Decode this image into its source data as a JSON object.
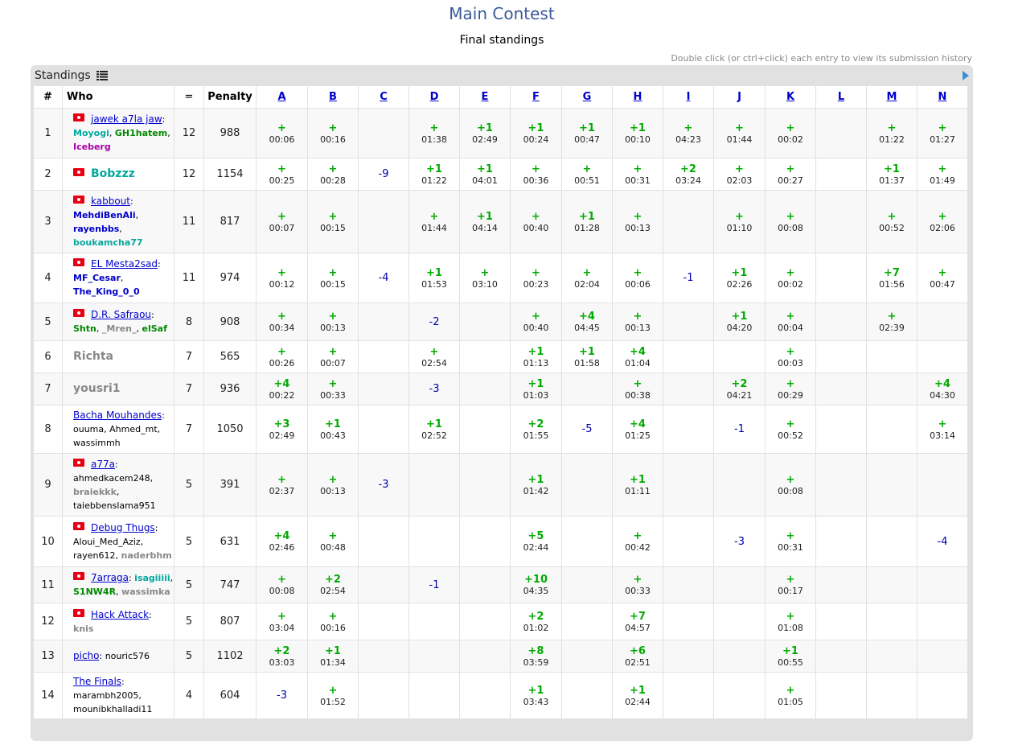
{
  "page": {
    "title": "Main Contest",
    "subtitle": "Final standings",
    "hint": "Double click (or ctrl+click) each entry to view its submission history",
    "box_title": "Standings"
  },
  "columns": {
    "rank": "#",
    "who": "Who",
    "solved": "=",
    "penalty": "Penalty",
    "problems": [
      "A",
      "B",
      "C",
      "D",
      "E",
      "F",
      "G",
      "H",
      "I",
      "J",
      "K",
      "L",
      "M",
      "N"
    ]
  },
  "rows": [
    {
      "rank": "1",
      "flag": true,
      "team": "jawek a7la jaw",
      "members": [
        [
          "Moyogi",
          "teal"
        ],
        [
          "GH1hatem",
          "green"
        ],
        [
          "Iceberg",
          "purple"
        ]
      ],
      "solved": "12",
      "penalty": "988",
      "cells": [
        [
          "+",
          "00:06"
        ],
        [
          "+",
          "00:16"
        ],
        null,
        [
          "+",
          "01:38"
        ],
        [
          "+1",
          "02:49"
        ],
        [
          "+1",
          "00:24"
        ],
        [
          "+1",
          "00:47"
        ],
        [
          "+1",
          "00:10"
        ],
        [
          "+",
          "04:23"
        ],
        [
          "+",
          "01:44"
        ],
        [
          "+",
          "00:02"
        ],
        null,
        [
          "+",
          "01:22"
        ],
        [
          "+",
          "01:27"
        ]
      ]
    },
    {
      "rank": "2",
      "flag": true,
      "single": "Bobzzz",
      "single_style": "big-teal",
      "solved": "12",
      "penalty": "1154",
      "cells": [
        [
          "+",
          "00:25"
        ],
        [
          "+",
          "00:28"
        ],
        [
          "-9",
          null
        ],
        [
          "+1",
          "01:22"
        ],
        [
          "+1",
          "04:01"
        ],
        [
          "+",
          "00:36"
        ],
        [
          "+",
          "00:51"
        ],
        [
          "+",
          "00:31"
        ],
        [
          "+2",
          "03:24"
        ],
        [
          "+",
          "02:03"
        ],
        [
          "+",
          "00:27"
        ],
        null,
        [
          "+1",
          "01:37"
        ],
        [
          "+",
          "01:49"
        ]
      ]
    },
    {
      "rank": "3",
      "flag": true,
      "team": "kabbout",
      "members": [
        [
          "MehdiBenAli",
          "navy"
        ],
        [
          "rayenbbs",
          "navy"
        ],
        [
          "boukamcha77",
          "teal"
        ]
      ],
      "solved": "11",
      "penalty": "817",
      "cells": [
        [
          "+",
          "00:07"
        ],
        [
          "+",
          "00:15"
        ],
        null,
        [
          "+",
          "01:44"
        ],
        [
          "+1",
          "04:14"
        ],
        [
          "+",
          "00:40"
        ],
        [
          "+1",
          "01:28"
        ],
        [
          "+",
          "00:13"
        ],
        null,
        [
          "+",
          "01:10"
        ],
        [
          "+",
          "00:08"
        ],
        null,
        [
          "+",
          "00:52"
        ],
        [
          "+",
          "02:06"
        ]
      ]
    },
    {
      "rank": "4",
      "flag": true,
      "team": "EL Mesta2sad",
      "members": [
        [
          "MF_Cesar",
          "navy"
        ],
        [
          "The_King_0_0",
          "navy"
        ]
      ],
      "solved": "11",
      "penalty": "974",
      "cells": [
        [
          "+",
          "00:12"
        ],
        [
          "+",
          "00:15"
        ],
        [
          "-4",
          null
        ],
        [
          "+1",
          "01:53"
        ],
        [
          "+",
          "03:10"
        ],
        [
          "+",
          "00:23"
        ],
        [
          "+",
          "02:04"
        ],
        [
          "+",
          "00:06"
        ],
        [
          "-1",
          null
        ],
        [
          "+1",
          "02:26"
        ],
        [
          "+",
          "00:02"
        ],
        null,
        [
          "+7",
          "01:56"
        ],
        [
          "+",
          "00:47"
        ]
      ]
    },
    {
      "rank": "5",
      "flag": true,
      "team": "D.R. Safraou",
      "members": [
        [
          "Shtn",
          "green"
        ],
        [
          "_Mren_",
          "gray"
        ],
        [
          "elSaf",
          "green"
        ]
      ],
      "solved": "8",
      "penalty": "908",
      "cells": [
        [
          "+",
          "00:34"
        ],
        [
          "+",
          "00:13"
        ],
        null,
        [
          "-2",
          null
        ],
        null,
        [
          "+",
          "00:40"
        ],
        [
          "+4",
          "04:45"
        ],
        [
          "+",
          "00:13"
        ],
        null,
        [
          "+1",
          "04:20"
        ],
        [
          "+",
          "00:04"
        ],
        null,
        [
          "+",
          "02:39"
        ],
        null
      ]
    },
    {
      "rank": "6",
      "flag": false,
      "single": "Richta",
      "single_style": "big-gray",
      "solved": "7",
      "penalty": "565",
      "cells": [
        [
          "+",
          "00:26"
        ],
        [
          "+",
          "00:07"
        ],
        null,
        [
          "+",
          "02:54"
        ],
        null,
        [
          "+1",
          "01:13"
        ],
        [
          "+1",
          "01:58"
        ],
        [
          "+4",
          "01:04"
        ],
        null,
        null,
        [
          "+",
          "00:03"
        ],
        null,
        null,
        null
      ]
    },
    {
      "rank": "7",
      "flag": false,
      "single": "yousri1",
      "single_style": "big-gray",
      "solved": "7",
      "penalty": "936",
      "cells": [
        [
          "+4",
          "00:22"
        ],
        [
          "+",
          "00:33"
        ],
        null,
        [
          "-3",
          null
        ],
        null,
        [
          "+1",
          "01:03"
        ],
        null,
        [
          "+",
          "00:38"
        ],
        null,
        [
          "+2",
          "04:21"
        ],
        [
          "+",
          "00:29"
        ],
        null,
        null,
        [
          "+4",
          "04:30"
        ]
      ]
    },
    {
      "rank": "8",
      "flag": false,
      "team": "Bacha Mouhandes",
      "members": [
        [
          "ouuma",
          "black"
        ],
        [
          "Ahmed_mt",
          "black"
        ],
        [
          "wassimmh",
          "black"
        ]
      ],
      "solved": "7",
      "penalty": "1050",
      "cells": [
        [
          "+3",
          "02:49"
        ],
        [
          "+1",
          "00:43"
        ],
        null,
        [
          "+1",
          "02:52"
        ],
        null,
        [
          "+2",
          "01:55"
        ],
        [
          "-5",
          null
        ],
        [
          "+4",
          "01:25"
        ],
        null,
        [
          "-1",
          null
        ],
        [
          "+",
          "00:52"
        ],
        null,
        null,
        [
          "+",
          "03:14"
        ]
      ]
    },
    {
      "rank": "9",
      "flag": true,
      "team": "a77a",
      "members": [
        [
          "ahmedkacem248",
          "black"
        ],
        [
          "braiekkk",
          "gray"
        ],
        [
          "taiebbenslama951",
          "black"
        ]
      ],
      "solved": "5",
      "penalty": "391",
      "cells": [
        [
          "+",
          "02:37"
        ],
        [
          "+",
          "00:13"
        ],
        [
          "-3",
          null
        ],
        null,
        null,
        [
          "+1",
          "01:42"
        ],
        null,
        [
          "+1",
          "01:11"
        ],
        null,
        null,
        [
          "+",
          "00:08"
        ],
        null,
        null,
        null
      ]
    },
    {
      "rank": "10",
      "flag": true,
      "team": "Debug Thugs",
      "members": [
        [
          "Aloui_Med_Aziz",
          "black"
        ],
        [
          "rayen612",
          "black"
        ],
        [
          "naderbhm",
          "gray"
        ]
      ],
      "solved": "5",
      "penalty": "631",
      "cells": [
        [
          "+4",
          "02:46"
        ],
        [
          "+",
          "00:48"
        ],
        null,
        null,
        null,
        [
          "+5",
          "02:44"
        ],
        null,
        [
          "+",
          "00:42"
        ],
        null,
        [
          "-3",
          null
        ],
        [
          "+",
          "00:31"
        ],
        null,
        null,
        [
          "-4",
          null
        ]
      ]
    },
    {
      "rank": "11",
      "flag": true,
      "team": "7arraga",
      "members": [
        [
          "isagiiiii",
          "teal"
        ],
        [
          "S1NW4R",
          "green"
        ],
        [
          "wassimka",
          "gray"
        ]
      ],
      "solved": "5",
      "penalty": "747",
      "cells": [
        [
          "+",
          "00:08"
        ],
        [
          "+2",
          "02:54"
        ],
        null,
        [
          "-1",
          null
        ],
        null,
        [
          "+10",
          "04:35"
        ],
        null,
        [
          "+",
          "00:33"
        ],
        null,
        null,
        [
          "+",
          "00:17"
        ],
        null,
        null,
        null
      ]
    },
    {
      "rank": "12",
      "flag": true,
      "team": "Hack Attack",
      "members": [
        [
          "knis",
          "gray"
        ]
      ],
      "solved": "5",
      "penalty": "807",
      "cells": [
        [
          "+",
          "03:04"
        ],
        [
          "+",
          "00:16"
        ],
        null,
        null,
        null,
        [
          "+2",
          "01:02"
        ],
        null,
        [
          "+7",
          "04:57"
        ],
        null,
        null,
        [
          "+",
          "01:08"
        ],
        null,
        null,
        null
      ]
    },
    {
      "rank": "13",
      "flag": false,
      "team": "picho",
      "members": [
        [
          "nouric576",
          "black"
        ]
      ],
      "solved": "5",
      "penalty": "1102",
      "cells": [
        [
          "+2",
          "03:03"
        ],
        [
          "+1",
          "01:34"
        ],
        null,
        null,
        null,
        [
          "+8",
          "03:59"
        ],
        null,
        [
          "+6",
          "02:51"
        ],
        null,
        null,
        [
          "+1",
          "00:55"
        ],
        null,
        null,
        null
      ]
    },
    {
      "rank": "14",
      "flag": false,
      "team": "The Finals",
      "members": [
        [
          "marambh2005",
          "black"
        ],
        [
          "mounibkhalladi11",
          "black"
        ]
      ],
      "solved": "4",
      "penalty": "604",
      "cells": [
        [
          "-3",
          null
        ],
        [
          "+",
          "01:52"
        ],
        null,
        null,
        null,
        [
          "+1",
          "03:43"
        ],
        null,
        [
          "+1",
          "02:44"
        ],
        null,
        null,
        [
          "+",
          "01:05"
        ],
        null,
        null,
        null
      ]
    }
  ]
}
